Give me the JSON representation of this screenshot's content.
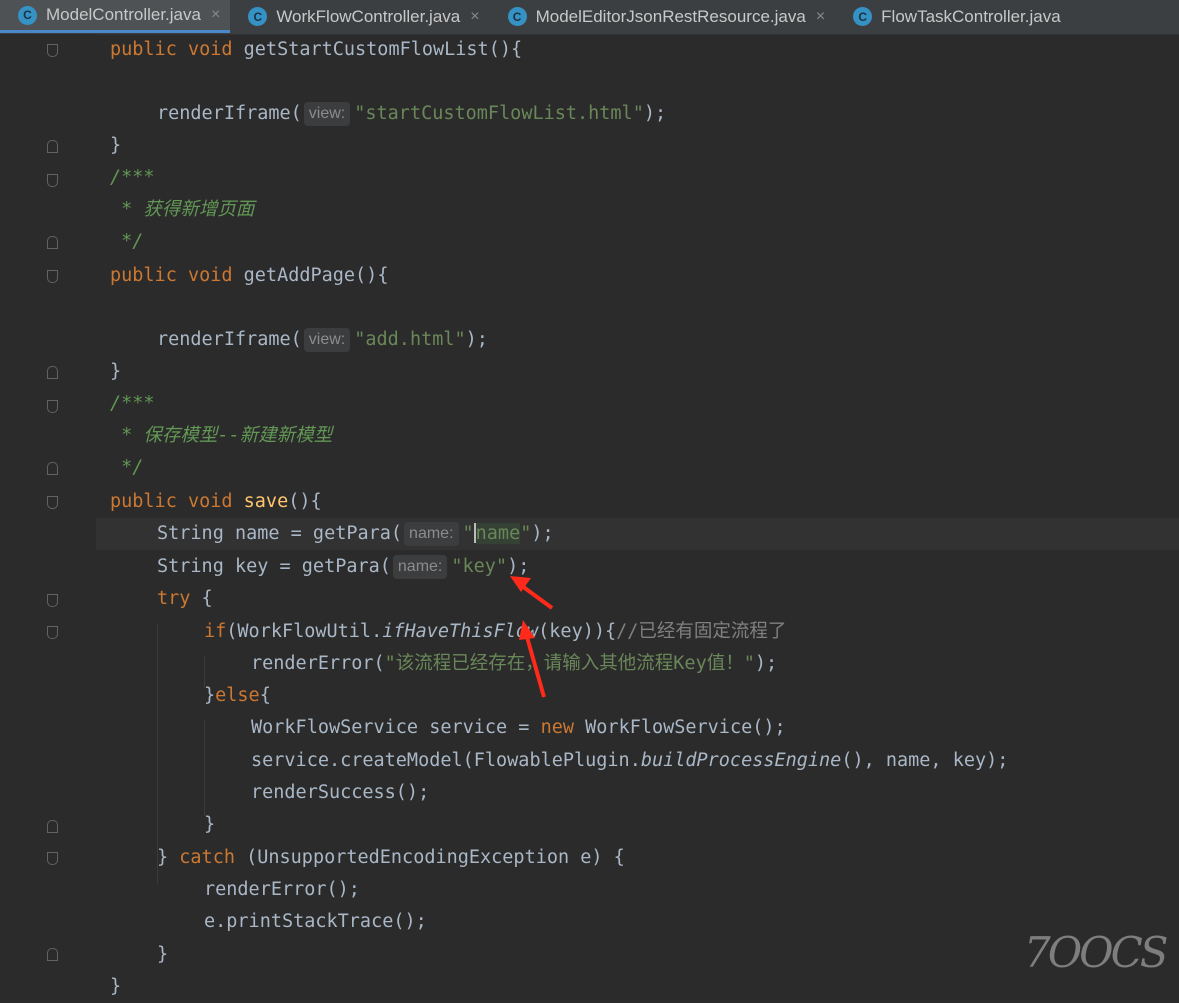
{
  "tabs": [
    {
      "label": "ModelController.java",
      "icon": "class-c-icon",
      "active": true
    },
    {
      "label": "WorkFlowController.java",
      "icon": "class-c-icon",
      "active": false
    },
    {
      "label": "ModelEditorJsonRestResource.java",
      "icon": "class-c-icon",
      "active": false
    },
    {
      "label": "FlowTaskController.java",
      "icon": "class-c-icon",
      "active": false
    }
  ],
  "tab_icon_letter": "C",
  "close_glyph": "×",
  "code": {
    "l1": {
      "kw": "public void ",
      "name": "getStartCustomFlowList",
      "rest": "(){"
    },
    "l3": {
      "call": "renderIframe(",
      "hint": "view:",
      "str": "\"startCustomFlowList.html\"",
      "end": ");"
    },
    "l4": {
      "text": "}"
    },
    "l5": {
      "text": "/***"
    },
    "l6": {
      "text": " * 获得新增页面"
    },
    "l7": {
      "text": " */"
    },
    "l8": {
      "kw": "public void ",
      "name": "getAddPage",
      "rest": "(){"
    },
    "l10": {
      "call": "renderIframe(",
      "hint": "view:",
      "str": "\"add.html\"",
      "end": ");"
    },
    "l11": {
      "text": "}"
    },
    "l12": {
      "text": "/***"
    },
    "l13": {
      "text": " * 保存模型--新建新模型"
    },
    "l14": {
      "text": " */"
    },
    "l15": {
      "kw": "public void ",
      "name": "save",
      "rest": "(){"
    },
    "l16": {
      "pre": "String name = getPara(",
      "hint": "name:",
      "q1": "\"",
      "strin": "name",
      "q2": "\"",
      "end": ");"
    },
    "l17": {
      "pre": "String key = getPara(",
      "hint": "name:",
      "str": "\"key\"",
      "end": ");"
    },
    "l18": {
      "kw": "try",
      "rest": " {"
    },
    "l19": {
      "kw": "if",
      "pre": "(WorkFlowUtil.",
      "method": "ifHaveThisFlow",
      "mid": "(key)){",
      "comment": "//已经有固定流程了"
    },
    "l20": {
      "call": "renderError(",
      "str": "\"该流程已经存在，请输入其他流程Key值！\"",
      "end": ");"
    },
    "l21": {
      "pre": "}",
      "kw": "else",
      "rest": "{"
    },
    "l22": {
      "pre": "WorkFlowService service = ",
      "kw": "new",
      "rest": " WorkFlowService();"
    },
    "l23": {
      "pre": "service.createModel(FlowablePlugin.",
      "method": "buildProcessEngine",
      "rest": "(), name, key);"
    },
    "l24": {
      "text": "renderSuccess();"
    },
    "l25": {
      "text": "}"
    },
    "l26": {
      "pre": "} ",
      "kw": "catch",
      "rest": " (UnsupportedEncodingException e) {"
    },
    "l27": {
      "text": "renderError();"
    },
    "l28": {
      "text": "e.printStackTrace();"
    },
    "l29": {
      "text": "}"
    },
    "l30": {
      "text": "}"
    }
  },
  "watermark": "7OOCS",
  "colors": {
    "background": "#2b2b2b",
    "keyword": "#cc7832",
    "method_decl": "#ffc66d",
    "string": "#6a8759",
    "doc_comment": "#629755",
    "annotation_arrow": "#ff2a1a"
  }
}
